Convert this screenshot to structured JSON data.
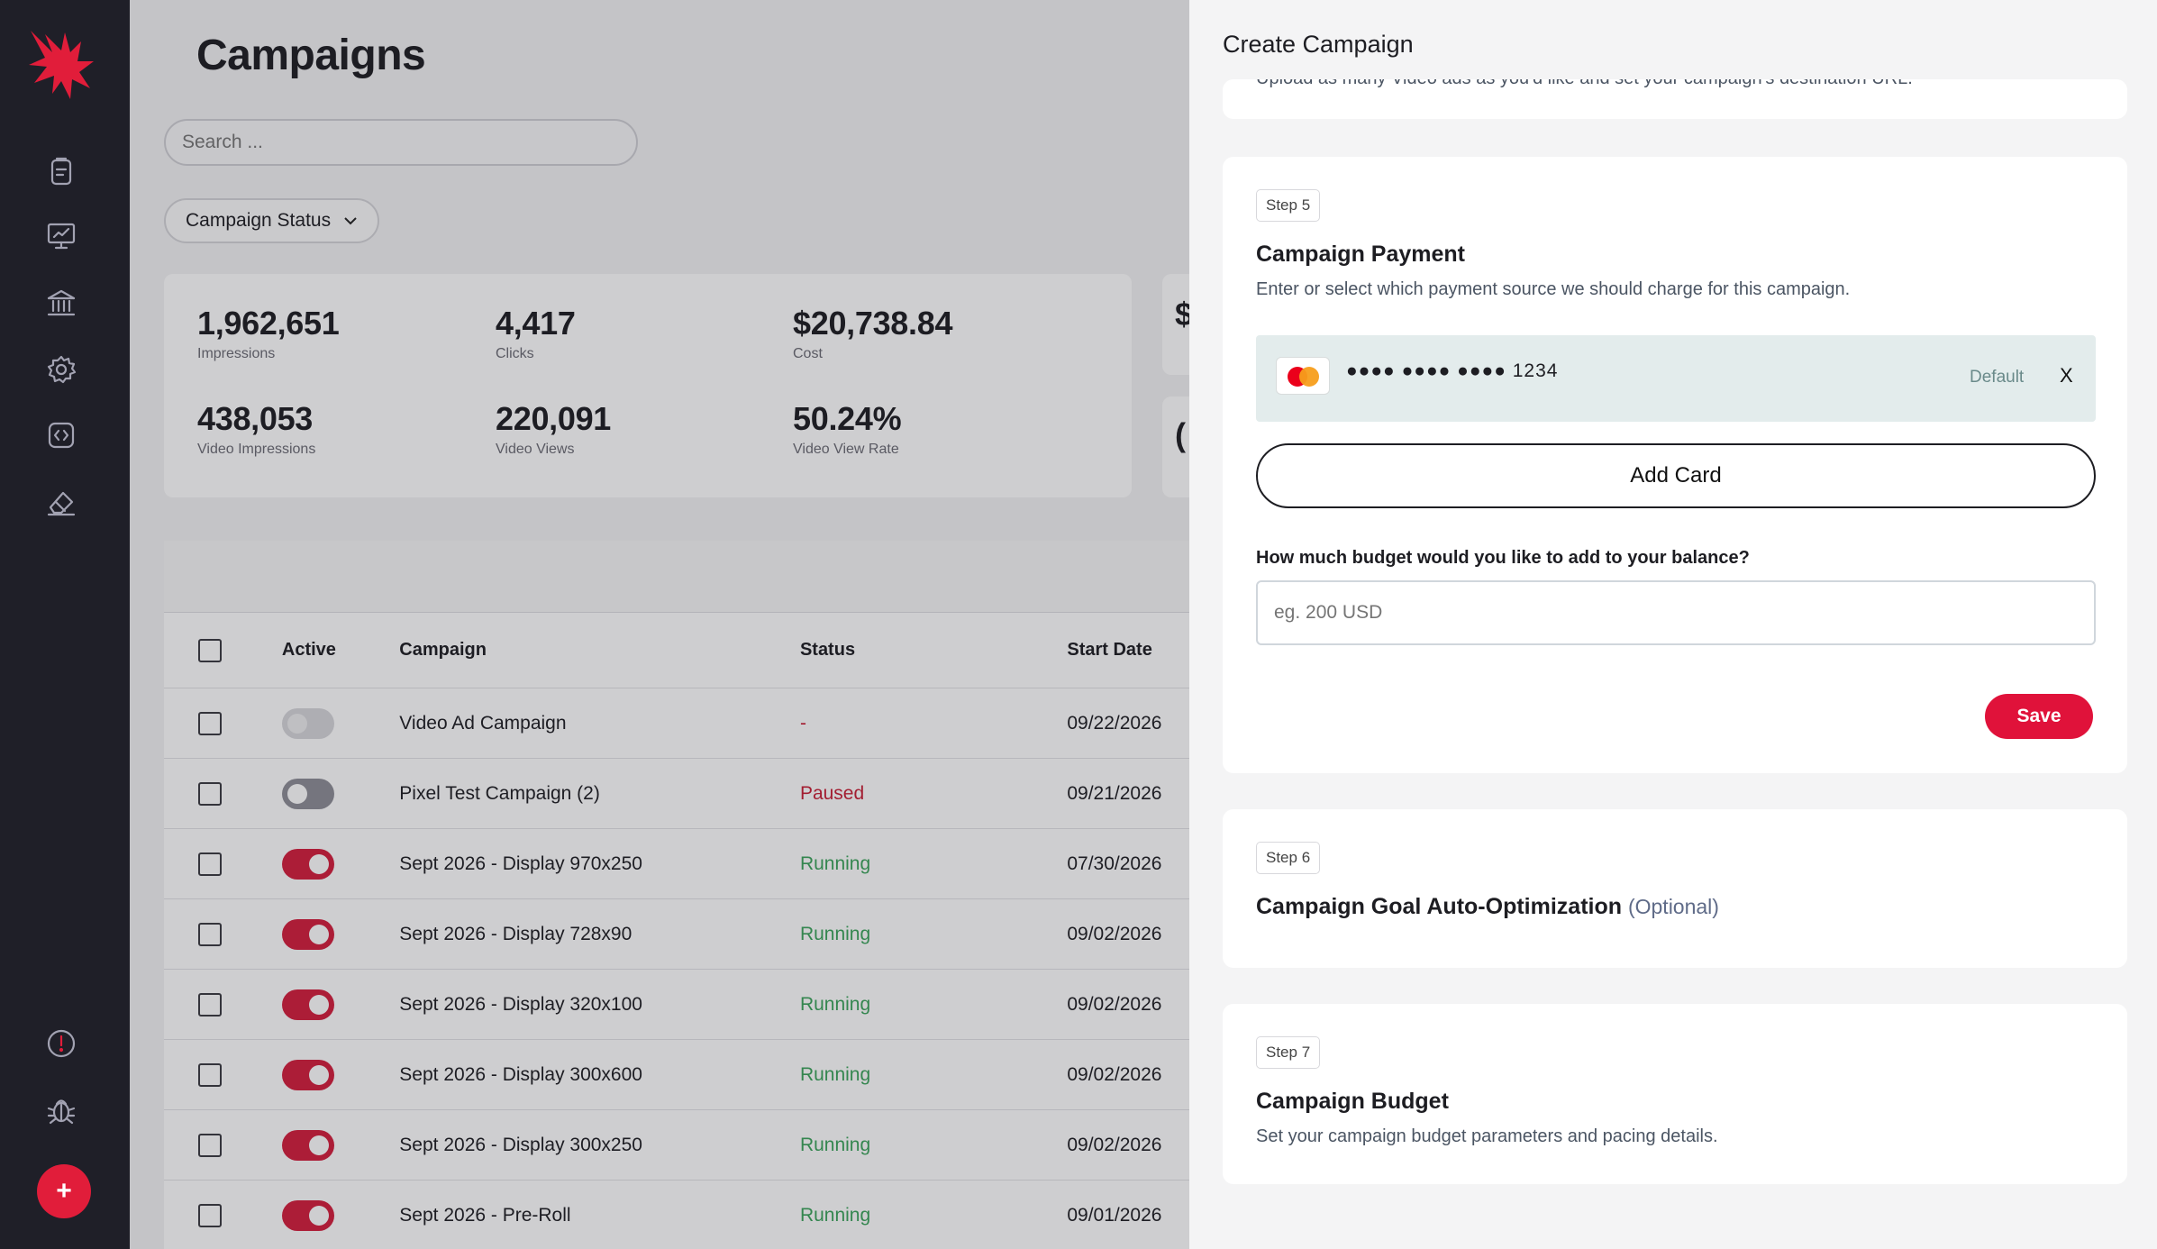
{
  "app": {
    "page_title": "Campaigns"
  },
  "filters": {
    "search_placeholder": "Search ...",
    "status_filter_label": "Campaign Status"
  },
  "stats": [
    {
      "value": "1,962,651",
      "label": "Impressions"
    },
    {
      "value": "4,417",
      "label": "Clicks"
    },
    {
      "value": "$20,738.84",
      "label": "Cost"
    },
    {
      "value": "438,053",
      "label": "Video Impressions"
    },
    {
      "value": "220,091",
      "label": "Video Views"
    },
    {
      "value": "50.24%",
      "label": "Video View Rate"
    }
  ],
  "side_cards": [
    {
      "value": "$"
    },
    {
      "value": "("
    }
  ],
  "table": {
    "headers": {
      "active": "Active",
      "campaign": "Campaign",
      "status": "Status",
      "start_date": "Start Date"
    },
    "rows": [
      {
        "active": "disabled",
        "name": "Video Ad Campaign",
        "status": "-",
        "status_type": "none",
        "start_date": "09/22/2026"
      },
      {
        "active": "off",
        "name": "Pixel Test Campaign (2)",
        "status": "Paused",
        "status_type": "paused",
        "start_date": "09/21/2026"
      },
      {
        "active": "on",
        "name": "Sept 2026 - Display 970x250",
        "status": "Running",
        "status_type": "running",
        "start_date": "07/30/2026"
      },
      {
        "active": "on",
        "name": "Sept 2026 - Display 728x90",
        "status": "Running",
        "status_type": "running",
        "start_date": "09/02/2026"
      },
      {
        "active": "on",
        "name": "Sept 2026 - Display 320x100",
        "status": "Running",
        "status_type": "running",
        "start_date": "09/02/2026"
      },
      {
        "active": "on",
        "name": "Sept 2026 - Display 300x600",
        "status": "Running",
        "status_type": "running",
        "start_date": "09/02/2026"
      },
      {
        "active": "on",
        "name": "Sept 2026 - Display 300x250",
        "status": "Running",
        "status_type": "running",
        "start_date": "09/02/2026"
      },
      {
        "active": "on",
        "name": "Sept 2026 - Pre-Roll",
        "status": "Running",
        "status_type": "running",
        "start_date": "09/01/2026"
      }
    ]
  },
  "drawer": {
    "title": "Create Campaign",
    "prev_card_text": "Upload as many Video ads as you'd like and set your campaign's destination URL.",
    "step5": {
      "badge": "Step 5",
      "title": "Campaign Payment",
      "desc": "Enter or select which payment source we should charge for this campaign.",
      "card_masked": "●●●● ●●●● ●●●●",
      "card_last4": "1234",
      "default_label": "Default",
      "remove_label": "X",
      "add_card_label": "Add Card",
      "budget_question": "How much budget would you like to add to your balance?",
      "budget_placeholder": "eg. 200 USD",
      "save_label": "Save"
    },
    "step6": {
      "badge": "Step 6",
      "title": "Campaign Goal Auto-Optimization",
      "optional": "(Optional)"
    },
    "step7": {
      "badge": "Step 7",
      "title": "Campaign Budget",
      "desc": "Set your campaign budget parameters and pacing details."
    }
  },
  "colors": {
    "sidebar_bg": "#1f1f28",
    "accent_red": "#e0123a",
    "running_green": "#3aa35a",
    "paused_red": "#c81d34"
  },
  "icons": {
    "logo": "eagle-logo",
    "nav": [
      "clipboard-icon",
      "presentation-chart-icon",
      "bank-icon",
      "settings-gear-icon",
      "code-icon",
      "eraser-icon"
    ],
    "bottom": [
      "alert-icon",
      "bug-icon"
    ],
    "fab": "plus-icon"
  }
}
